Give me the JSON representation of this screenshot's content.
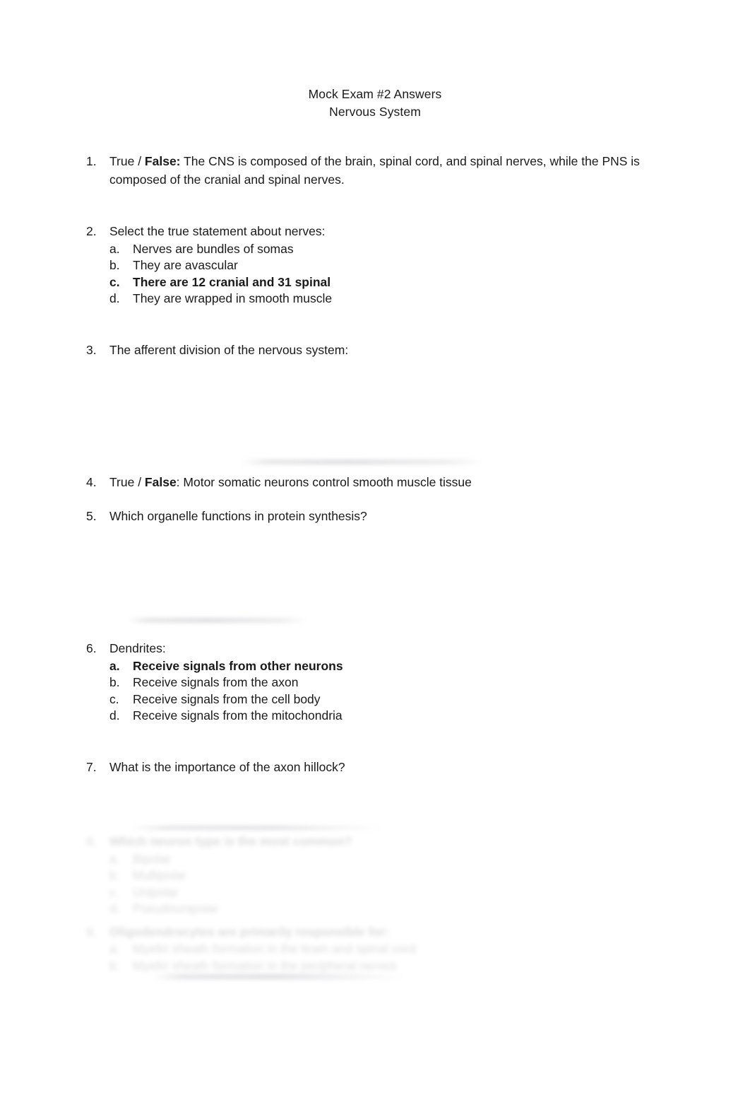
{
  "document": {
    "title_lines": [
      "Mock Exam #2 Answers",
      "Nervous System"
    ]
  },
  "questions": [
    {
      "number": "1.",
      "prefix": "True / ",
      "answer_bold": "False:",
      "text": " The CNS is composed of the brain, spinal cord, and spinal nerves, while the PNS is composed of the cranial and spinal nerves.",
      "options": []
    },
    {
      "number": "2.",
      "text": "Select the true statement about nerves:",
      "options": [
        {
          "letter": "a.",
          "text": "Nerves are bundles of somas",
          "correct": false
        },
        {
          "letter": "b.",
          "text": "They are avascular",
          "correct": false
        },
        {
          "letter": "c.",
          "text": "There are 12 cranial and 31 spinal",
          "correct": true
        },
        {
          "letter": "d.",
          "text": "They are wrapped in smooth muscle",
          "correct": false
        }
      ]
    },
    {
      "number": "3.",
      "text": "The afferent division of the nervous system:",
      "options": []
    },
    {
      "number": "4.",
      "prefix": "True / ",
      "answer_bold": "False",
      "text": ": Motor somatic neurons control smooth muscle tissue",
      "options": []
    },
    {
      "number": "5.",
      "text": "Which organelle functions in protein synthesis?",
      "options": []
    },
    {
      "number": "6.",
      "text": "Dendrites:",
      "options": [
        {
          "letter": "a.",
          "text": "Receive signals from other neurons",
          "correct": true
        },
        {
          "letter": "b.",
          "text": "Receive signals from the axon",
          "correct": false
        },
        {
          "letter": "c.",
          "text": "Receive signals from the cell body",
          "correct": false
        },
        {
          "letter": "d.",
          "text": "Receive signals from the mitochondria",
          "correct": false
        }
      ]
    },
    {
      "number": "7.",
      "text": "What is the importance of the axon hillock?",
      "options": []
    }
  ],
  "faded_questions": [
    {
      "number": "8.",
      "text": "Which neuron type is the most common?",
      "options": [
        {
          "letter": "a.",
          "text": "Bipolar"
        },
        {
          "letter": "b.",
          "text": "Multipolar"
        },
        {
          "letter": "c.",
          "text": "Unipolar"
        },
        {
          "letter": "d.",
          "text": "Pseudounipolar"
        }
      ]
    },
    {
      "number": "9.",
      "text": "Oligodendrocytes are primarily responsible for:",
      "options": [
        {
          "letter": "a.",
          "text": "Myelin sheath formation in the brain and spinal cord"
        },
        {
          "letter": "b.",
          "text": "Myelin sheath formation in the peripheral nerves"
        }
      ]
    }
  ]
}
